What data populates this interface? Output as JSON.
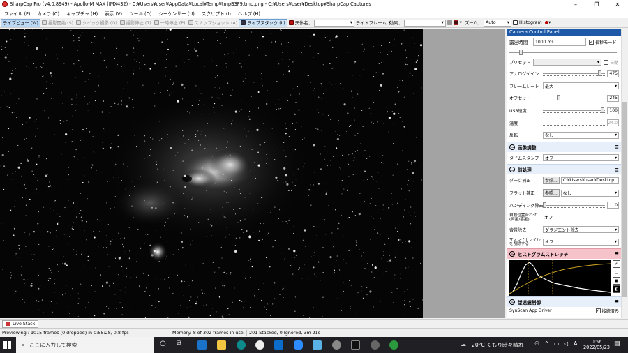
{
  "window": {
    "title": "SharpCap Pro (v4.0.8949) - Apollo-M MAX (IMX432) - C:¥Users¥user¥AppData¥Local¥Temp¥tmpB3F9.tmp.png - C:¥Users¥user¥Desktop¥SharpCap Captures",
    "minimize": "–",
    "restore": "❐",
    "close": "✕"
  },
  "menu": [
    "ファイル (F)",
    "カメラ (C)",
    "キャプチャ (H)",
    "表示 (V)",
    "ツール (O)",
    "シーケンサー (U)",
    "スクリプト (I)",
    "ヘルプ (H)"
  ],
  "toolbar": {
    "live_view": "ライブビュー (W)",
    "start_capture": "撮影開始 (S)",
    "quick_capture": "クイック撮影 (Q)",
    "stop_capture": "撮影停止 (T)",
    "pause": "一時停止 (P)",
    "snapshot": "スナップショット (A)",
    "live_stack": "ライブスタック (L)",
    "target_label": "天体名：",
    "target_value": "",
    "frame_label": "ライトフレーム",
    "effect_label": "効果：",
    "effect_value": "",
    "zoom_label": "ズーム：",
    "zoom_value": "Auto",
    "histogram": "Histogram"
  },
  "panel": {
    "title": "Camera Control Panel",
    "exposure_label": "露出時間",
    "exposure_value": "1000 ms",
    "long_exposure_label": "長秒モード",
    "long_exposure_checked": true,
    "preset_label": "プリセット",
    "preset_value": "",
    "auto_label": "自動",
    "gain_label": "アナログゲイン",
    "gain_value": "475",
    "gain_level": 0.95,
    "framerate_label": "フレームレート",
    "framerate_value": "最大",
    "offset_label": "オフセット",
    "offset_value": "245",
    "offset_level": 0.24,
    "usb_label": "USB速度",
    "usb_value": "100",
    "usb_level": 1.0,
    "temp_label": "温度",
    "temp_value": "24.0",
    "flip_label": "反転",
    "flip_value": "なし",
    "image_section": "画像調整",
    "timestamp_label": "タイムスタンプ",
    "timestamp_value": "オフ",
    "pre_section": "前処理",
    "dark_label": "ダーク補正",
    "dark_browse": "参照...",
    "dark_value": "C:¥Users¥user¥Desktop…",
    "flat_label": "フラット補正",
    "flat_browse": "参照...",
    "flat_value": "なし",
    "banding_label": "バンディング除去",
    "banding_value": "0",
    "align_label": "自動位置合わせ (恒星/惑星)",
    "align_value": "オフ",
    "bg_label": "背景除去",
    "bg_value": "グラジエント除去",
    "sat_label": "サテライトレイルを削除する",
    "sat_value": "オフ",
    "hist_section": "ヒストグラムストレッチ",
    "scope_section": "望遠鏡制御",
    "scope_driver": "SynScan App Driver",
    "scope_connected": "接続済み"
  },
  "livestack_tab": "Live Stack",
  "status": {
    "preview": "Previewing : 1015 frames (0 dropped) in 0:55:28, 0.8 fps",
    "memory": "Memory: 8 of 302 frames in use.",
    "stacked": "201 Stacked, 0 Ignored, 3m 21s"
  },
  "taskbar": {
    "search_placeholder": "ここに入力して検索",
    "weather": "20°C くもり時々晴れ",
    "ime": "A",
    "time": "0:56",
    "date": "2022/05/23"
  }
}
